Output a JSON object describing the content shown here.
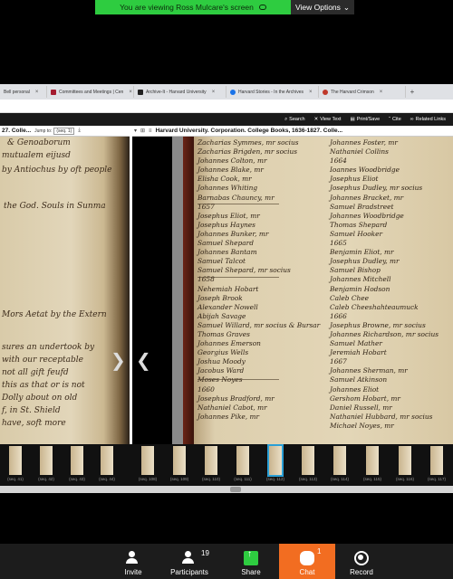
{
  "banner": {
    "sharing_text": "You are viewing Ross Mulcare's screen",
    "view_options": "View Options"
  },
  "browser": {
    "tabs": [
      {
        "label": "Bell personal",
        "color": "#888888"
      },
      {
        "label": "Committees and Meetings | Cen",
        "color": "#a51c30"
      },
      {
        "label": "Archive-It - Harvard University",
        "color": "#222222"
      },
      {
        "label": "Harvard Stories - In the Archives",
        "color": "#1a73e8"
      },
      {
        "label": "The Harvard Crimson",
        "color": "#c0392b"
      }
    ]
  },
  "viewer_toolbar": {
    "search": "Search",
    "view_text": "View Text",
    "print_save": "Print/Save",
    "cite": "Cite",
    "related_links": "Related Links"
  },
  "left_pane": {
    "title_fragment": "27. Colle...",
    "jump_label": "Jump to:",
    "seq_value": "(seq. 1)"
  },
  "right_pane": {
    "title": "Harvard University. Corporation. College Books, 1636-1827. Colle..."
  },
  "manuscript_left": [
    "& Genoaborum",
    "mutualem eijusd",
    "by Antiochus by oft people",
    "the God. Souls in Sunma",
    "Mors Aetat by the Extern",
    "sures an undertook by",
    "with our receptable",
    "not all gift feufd",
    "this as that or is not",
    "Dolly about on old",
    "f, in St. Shield",
    "have, soft more"
  ],
  "manuscript_right": {
    "col1_names": [
      "Zacharias Symmes, mr socius",
      "Zacharias Brigden, mr socius",
      "Johannes Colton, mr",
      "Johannes Blake, mr",
      "Elisha Cook, mr",
      "Johannes Whiting",
      "Barnabas Chauncy, mr",
      "1657",
      "Josephus Eliot, mr",
      "Josephus Haynes",
      "Johannes Bunker, mr",
      "Samuel Shepard",
      "Johannes Bantam",
      "Samuel Talcot",
      "Samuel Shepard, mr socius",
      "1658",
      "Nehemiah Hobart",
      "Joseph Brook",
      "Alexander Nowell",
      "Abijah Savage",
      "Samuel Willard, mr socius & Bursar",
      "Thomas Graves",
      "Johannes Emerson",
      "Georgius Wells",
      "Joshua Moody",
      "Jacobus Ward",
      "Moses Noyes",
      "1660",
      "Josephus Bradford, mr",
      "Nathaniel Cabot, mr",
      "Johannes Pike, mr"
    ],
    "col2_names": [
      "Johannes Foster, mr",
      "Nathaniel Collins",
      "1664",
      "Ioannes Woodbridge",
      "Josephus Eliot",
      "Josephus Dudley, mr socius",
      "Johannes Bracket, mr",
      "Samuel Bradstreet",
      "Johannes Woodbridge",
      "Thomas Shepard",
      "Samuel Hooker",
      "1665",
      "Benjamin Eliot, mr",
      "Josephus Dudley, mr",
      "Samuel Bishop",
      "Johannes Mitchell",
      "Benjamin Hodson",
      "Caleb Chee",
      "Caleb Cheeshahteaumuck",
      "1666",
      "Josephus Browne, mr socius",
      "Johannes Richardson, mr socius",
      "Samuel Mather",
      "Jeremiah Hobart",
      "1667",
      "Johannes Sherman, mr",
      "Samuel Atkinson",
      "Johannes Eliot",
      "Gershom Hobart, mr",
      "Daniel Russell, mr",
      "Nathaniel Hubbard, mr socius",
      "Michael Noyes, mr"
    ]
  },
  "thumbnails": [
    "(seq. 41)",
    "(seq. 42)",
    "(seq. 43)",
    "(seq. 44)",
    "(seq. 108)",
    "(seq. 109)",
    "(seq. 110)",
    "(seq. 111)",
    "(seq. 112)",
    "(seq. 113)",
    "(seq. 114)",
    "(seq. 115)",
    "(seq. 116)",
    "(seq. 117)"
  ],
  "selected_thumb": "(seq. 112)",
  "controls": {
    "invite": "Invite",
    "participants": "Participants",
    "participants_count": "19",
    "share": "Share",
    "chat": "Chat",
    "chat_badge": "1",
    "record": "Record"
  },
  "colors": {
    "banner_green": "#2ecc40",
    "chat_orange": "#f26d21",
    "selection_blue": "#2a9fd6"
  }
}
